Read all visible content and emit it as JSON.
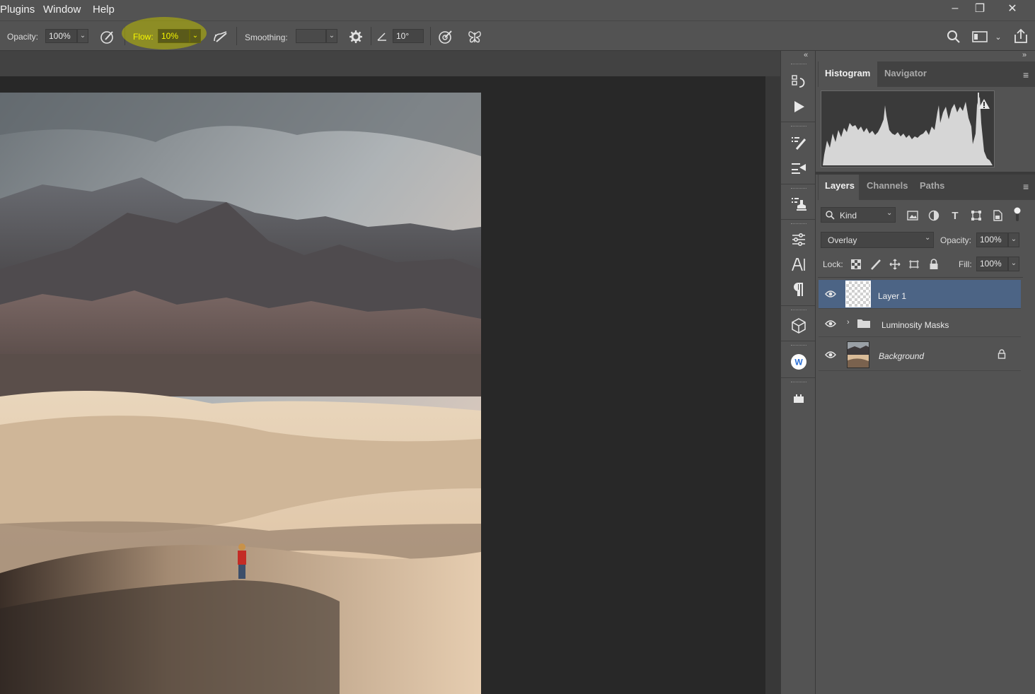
{
  "menu": {
    "items": [
      "Plugins",
      "Window",
      "Help"
    ]
  },
  "window_controls": {
    "minimize": "–",
    "restore": "❐",
    "close": "✕"
  },
  "options_bar": {
    "opacity_label": "Opacity:",
    "opacity_value": "100%",
    "flow_label": "Flow:",
    "flow_value": "10%",
    "smoothing_label": "Smoothing:",
    "smoothing_value": "",
    "angle_value": "10°",
    "highlight_color": "#e8e800"
  },
  "histogram_panel": {
    "tabs": [
      "Histogram",
      "Navigator"
    ],
    "active_tab": "Histogram",
    "warning_icon": "warning-icon"
  },
  "layers_panel": {
    "tabs": [
      "Layers",
      "Channels",
      "Paths"
    ],
    "active_tab": "Layers",
    "filter_kind": "Kind",
    "blend_mode": "Overlay",
    "opacity_label": "Opacity:",
    "opacity_value": "100%",
    "lock_label": "Lock:",
    "fill_label": "Fill:",
    "fill_value": "100%",
    "layers": [
      {
        "name": "Layer 1",
        "selected": true,
        "visible": true,
        "type": "pixel"
      },
      {
        "name": "Luminosity Masks",
        "selected": false,
        "visible": true,
        "type": "group"
      },
      {
        "name": "Background",
        "selected": false,
        "visible": true,
        "type": "background",
        "locked": true
      }
    ],
    "selected_color": "#4c6485"
  },
  "icon_column": {
    "icons": [
      "history-icon",
      "actions-play-icon",
      "brush-settings-icon",
      "brush-presets-icon",
      "clone-source-icon",
      "adjustments-icon",
      "character-icon",
      "paragraph-icon",
      "3d-icon",
      "w-plugin-icon",
      "plugin-icon"
    ]
  }
}
